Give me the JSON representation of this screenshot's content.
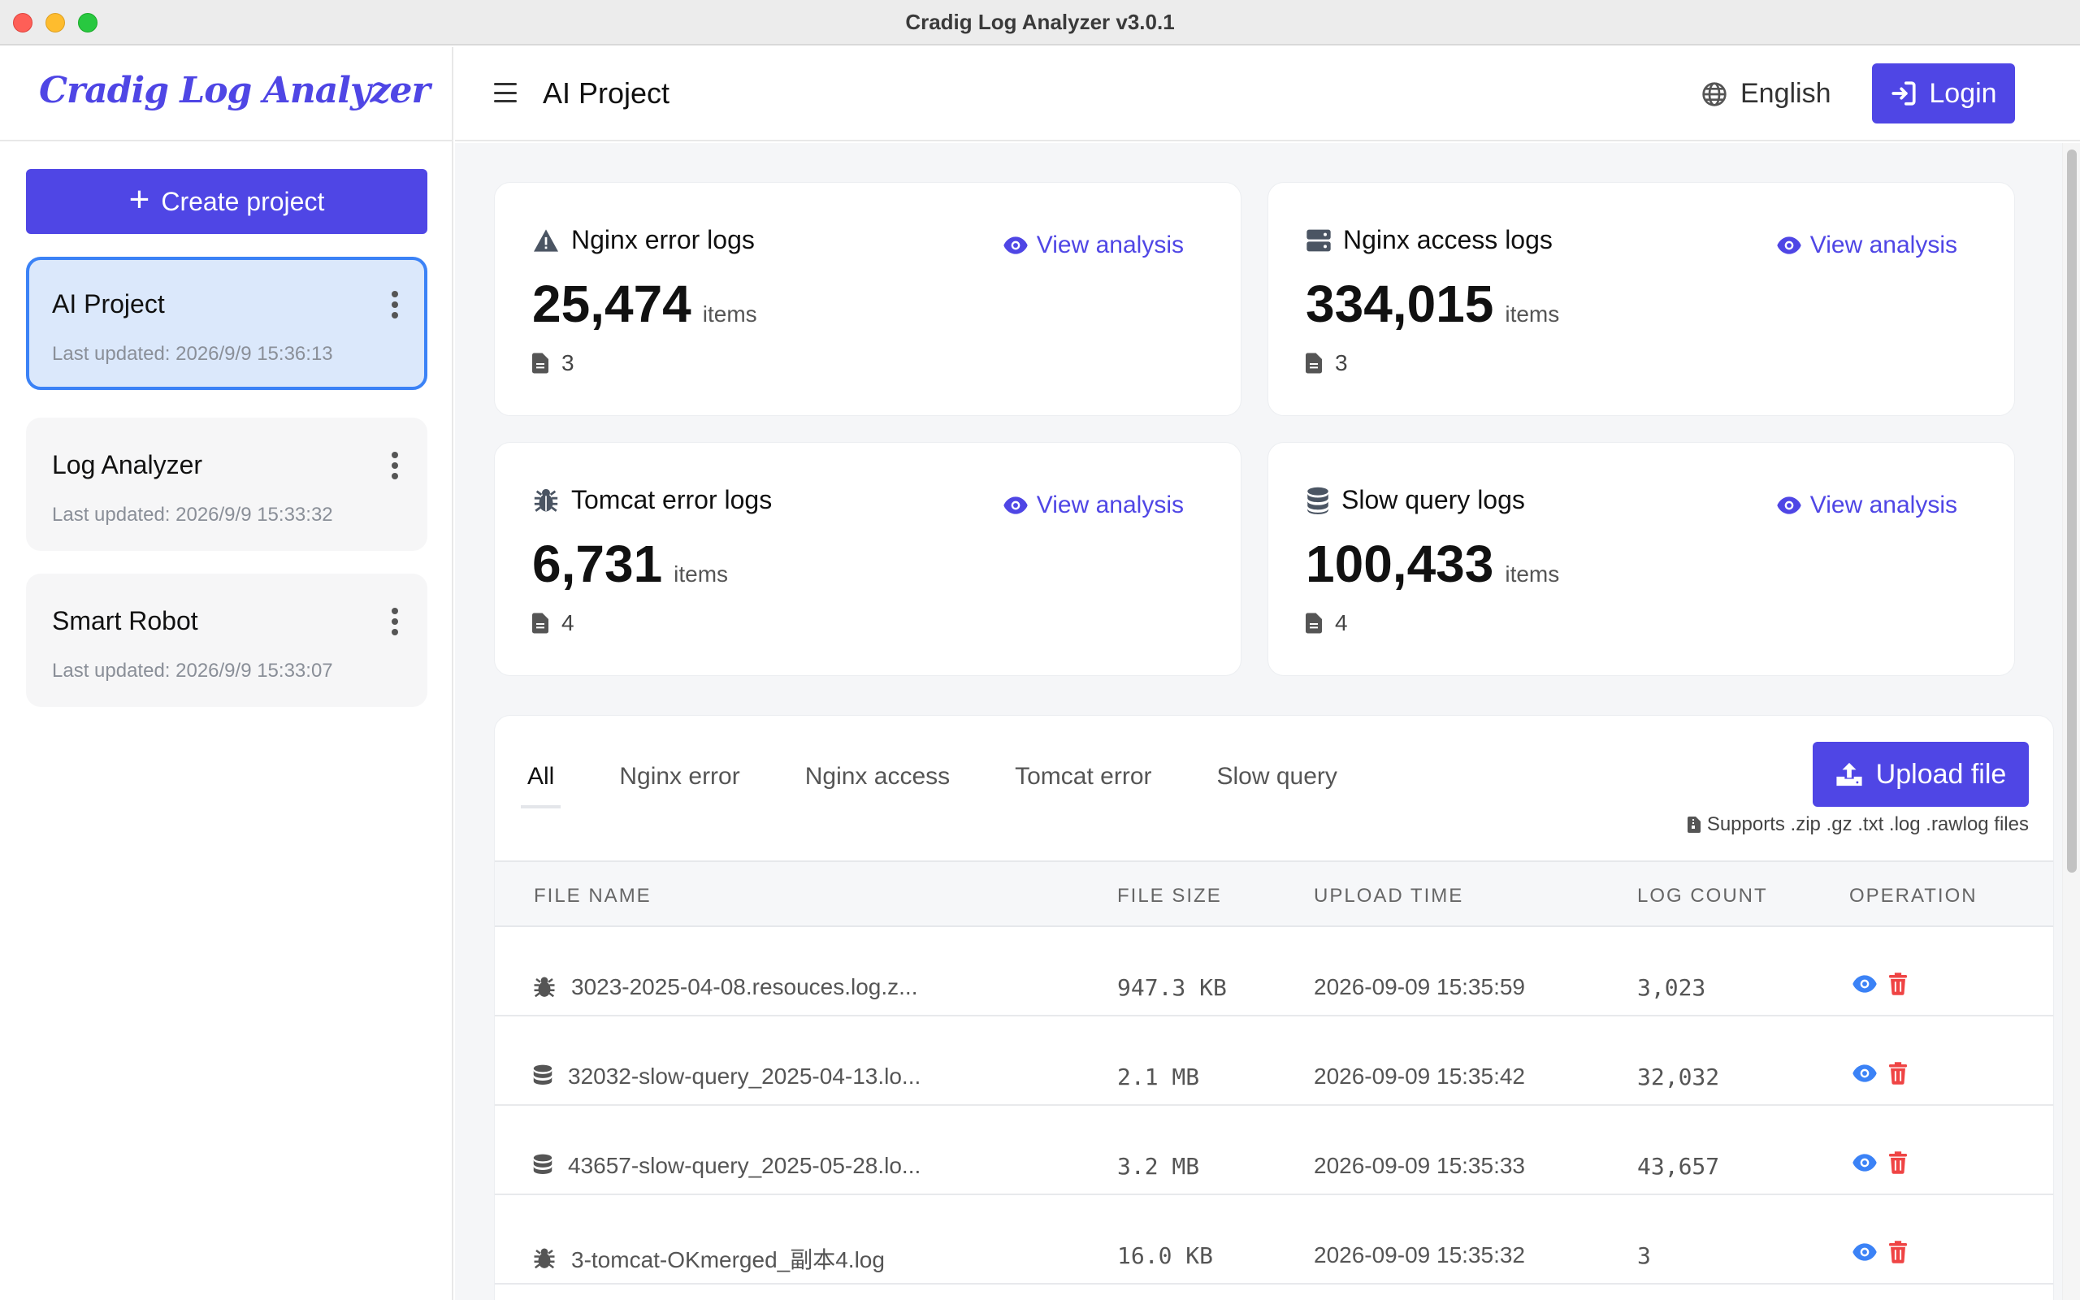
{
  "window": {
    "title": "Cradig Log Analyzer v3.0.1"
  },
  "sidebar": {
    "brand": "Cradig Log Analyzer",
    "create_label": "Create project",
    "projects": [
      {
        "name": "AI Project",
        "updated": "Last updated: 2026/9/9 15:36:13",
        "active": true
      },
      {
        "name": "Log Analyzer",
        "updated": "Last updated: 2026/9/9 15:33:32",
        "active": false
      },
      {
        "name": "Smart Robot",
        "updated": "Last updated: 2026/9/9 15:33:07",
        "active": false
      }
    ]
  },
  "header": {
    "title": "AI Project",
    "language": "English",
    "login_label": "Login"
  },
  "stats": [
    {
      "icon": "warning-icon",
      "title": "Nginx error logs",
      "count": "25,474",
      "unit": "items",
      "files": "3",
      "view_label": "View analysis"
    },
    {
      "icon": "server-icon",
      "title": "Nginx access logs",
      "count": "334,015",
      "unit": "items",
      "files": "3",
      "view_label": "View analysis"
    },
    {
      "icon": "bug-icon",
      "title": "Tomcat error logs",
      "count": "6,731",
      "unit": "items",
      "files": "4",
      "view_label": "View analysis"
    },
    {
      "icon": "database-icon",
      "title": "Slow query logs",
      "count": "100,433",
      "unit": "items",
      "files": "4",
      "view_label": "View analysis"
    }
  ],
  "files": {
    "tabs": [
      "All",
      "Nginx error",
      "Nginx access",
      "Tomcat error",
      "Slow query"
    ],
    "active_tab": "All",
    "upload_label": "Upload file",
    "upload_note": "Supports .zip .gz .txt .log .rawlog files",
    "columns": [
      "FILE NAME",
      "FILE SIZE",
      "UPLOAD TIME",
      "LOG COUNT",
      "OPERATION"
    ],
    "rows": [
      {
        "icon": "bug-icon",
        "name": "3023-2025-04-08.resouces.log.z...",
        "size": "947.3 KB",
        "time": "2026-09-09 15:35:59",
        "count": "3,023"
      },
      {
        "icon": "database-icon",
        "name": "32032-slow-query_2025-04-13.lo...",
        "size": "2.1 MB",
        "time": "2026-09-09 15:35:42",
        "count": "32,032"
      },
      {
        "icon": "database-icon",
        "name": "43657-slow-query_2025-05-28.lo...",
        "size": "3.2 MB",
        "time": "2026-09-09 15:35:33",
        "count": "43,657"
      },
      {
        "icon": "bug-icon",
        "name": "3-tomcat-OKmerged_副本4.log",
        "size": "16.0 KB",
        "time": "2026-09-09 15:35:32",
        "count": "3"
      }
    ]
  },
  "colors": {
    "accent": "#4f46e5",
    "active_border": "#3b82f6",
    "active_bg": "#dbe8fb",
    "eye": "#3b82f6",
    "delete": "#ef4444"
  }
}
